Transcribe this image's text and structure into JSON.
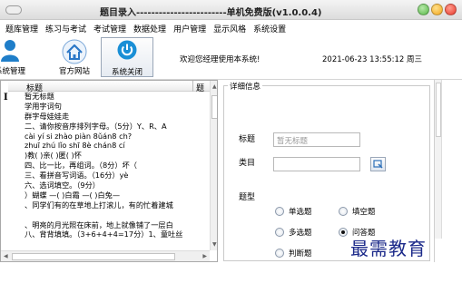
{
  "window": {
    "title": "题目录入------------------------单机免费版(v1.0.0.4)"
  },
  "menu": [
    "题库管理",
    "练习与考试",
    "考试管理",
    "数据处理",
    "用户管理",
    "显示风格",
    "系统设置"
  ],
  "toolbar": {
    "buttons": [
      {
        "label": "系统管理",
        "icon": "user-icon"
      },
      {
        "label": "官方网站",
        "icon": "home-icon"
      },
      {
        "label": "系统关闭",
        "icon": "power-icon"
      }
    ],
    "welcome": "欢迎您经理使用本系统!",
    "datetime": "2021-06-23 13:55:12  周三"
  },
  "list": {
    "col_title": "标题",
    "col_type": "题",
    "rows": [
      "暂无标题",
      "学用字词句",
      "群字母娃娃走",
      "二、请你按音序排列字母。（5分）Y、R、A",
      "cài  yí  si  zhào  piàn  8ǔán8 ch?",
      "zhuī  zhú  lǐo  shī   8è  chán8  cí",
      ")教(   )亲(   )匿(   )怀",
      "四、比一比，再组词。（8分）坏（",
      "三、看拼音写词语。（16分）yè",
      "六、选词填空。（9分）",
      "）蝴蝶   —(   )白霜  —(   )白兔—",
      "、同学们有的在草地上打滚儿，有的忙着建城",
      "",
      "、明亮的月光照在床前，地上就像铺了一层白",
      "八、背背填填。（3+6+4+4=17分）1、童吐丝"
    ]
  },
  "detail": {
    "legend": "详细信息",
    "title_label": "标题",
    "title_placeholder": "暂无标题",
    "category_label": "类目",
    "type_label": "题型",
    "types": [
      {
        "label": "单选题",
        "selected": false
      },
      {
        "label": "填空题",
        "selected": false
      },
      {
        "label": "多选题",
        "selected": false
      },
      {
        "label": "问答题",
        "selected": true
      },
      {
        "label": "判断题",
        "selected": false
      }
    ]
  },
  "colors": {
    "close": "#e8382a",
    "max": "#f2a51c",
    "min": "#57b847",
    "power": "#1a8fd6",
    "user": "#1f7ec9"
  }
}
